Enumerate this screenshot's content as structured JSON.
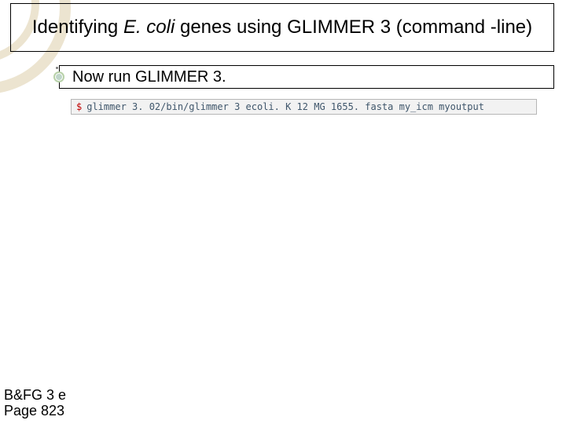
{
  "title": {
    "pre": "Identifying ",
    "italic": "E. coli",
    "post": " genes using GLIMMER 3 (command -line)"
  },
  "bullet": {
    "text": "Now run GLIMMER 3."
  },
  "command": {
    "prompt": "$",
    "line": "glimmer 3. 02/bin/glimmer 3 ecoli. K 12 MG 1655. fasta my_icm myoutput"
  },
  "footer": {
    "line1": "B&FG 3 e",
    "line2": "Page 823"
  }
}
